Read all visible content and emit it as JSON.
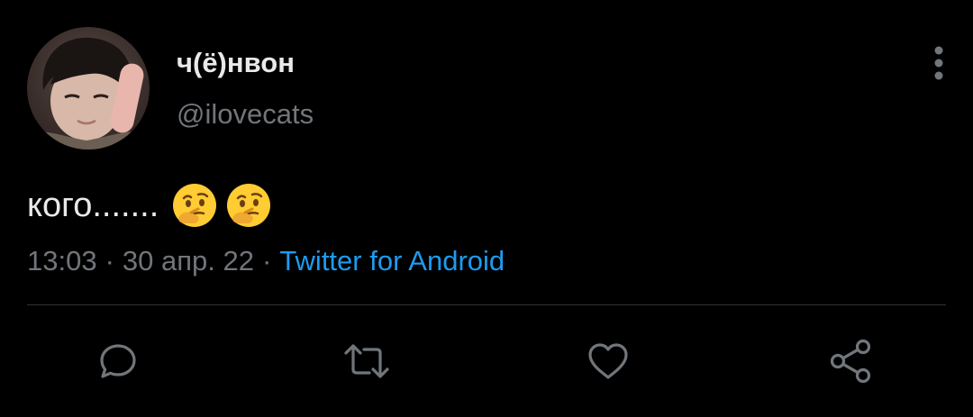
{
  "tweet": {
    "display_name": "ч(ё)нвон",
    "handle": "@ilovecats",
    "text": "кого.......",
    "emojis": [
      "thinking-face-icon",
      "thinking-face-icon"
    ],
    "time": "13:03",
    "date": "30 апр. 22",
    "separator": "·",
    "source": "Twitter for Android"
  },
  "actions": [
    {
      "name": "reply",
      "icon": "reply-icon"
    },
    {
      "name": "retweet",
      "icon": "retweet-icon"
    },
    {
      "name": "like",
      "icon": "heart-icon"
    },
    {
      "name": "share",
      "icon": "share-icon"
    }
  ],
  "colors": {
    "background": "#000000",
    "text": "#e7e9ea",
    "muted": "#71767b",
    "link": "#1d9bf0",
    "divider": "#2f3336",
    "icon": "#71767b"
  }
}
